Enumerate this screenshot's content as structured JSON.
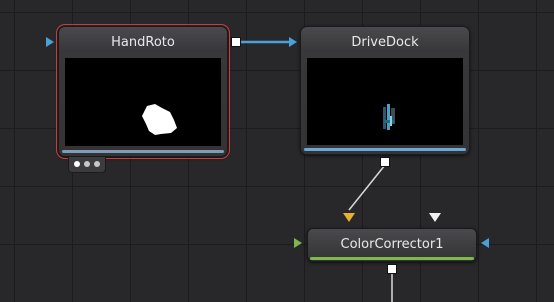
{
  "nodes": {
    "handroto": {
      "title": "HandRoto",
      "selected": true,
      "accent": "#d23a3a",
      "bar_color": "#6d8fb0"
    },
    "drivedock": {
      "title": "DriveDock",
      "bar_color": "#6da9d6"
    },
    "color_corrector": {
      "title": "ColorCorrector1",
      "bar_color": "#7db84a"
    }
  },
  "colors": {
    "background": "#28282a",
    "grid": "#1c1c1e",
    "wire_blue": "#4aa0d8",
    "wire_white": "#e0e0e0",
    "input_yellow": "#e8b030",
    "input_green": "#7db84a",
    "input_blue": "#4aa0d8",
    "input_white": "#f0f0f0"
  },
  "icons": [
    "input-triangle-icon",
    "output-square-icon",
    "expander-dots-icon"
  ]
}
